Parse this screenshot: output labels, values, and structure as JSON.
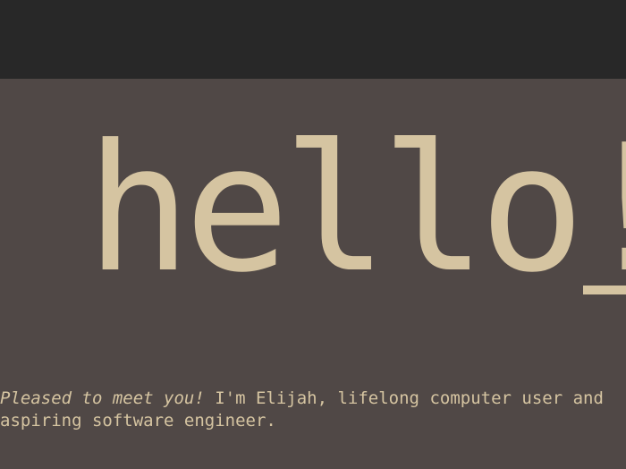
{
  "hero": {
    "heading": "hello!",
    "greeting": "Pleased to meet you!",
    "intro_line1": " I'm Elijah, lifelong computer user and",
    "intro_line2": "aspiring software engineer."
  },
  "colors": {
    "topbar": "#282828",
    "background": "#504846",
    "text": "#d5c4a1"
  }
}
